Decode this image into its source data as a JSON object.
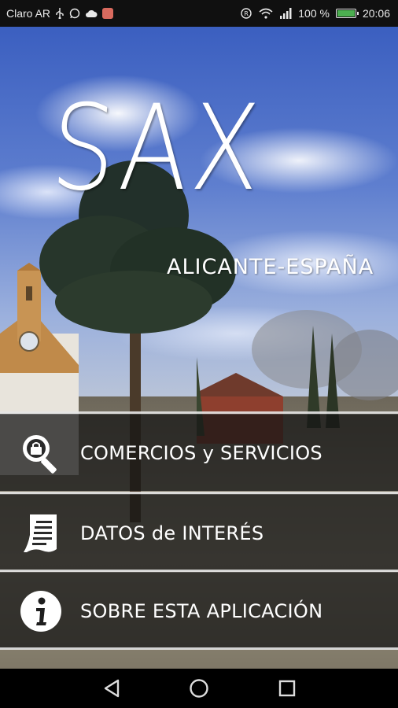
{
  "status_bar": {
    "carrier": "Claro AR",
    "battery_percent": "100 %",
    "time": "20:06",
    "battery_level": 1.0,
    "icons": [
      "usb-icon",
      "whatsapp-icon",
      "cloud-icon",
      "app-notification-icon",
      "alarm-icon",
      "wifi-icon",
      "signal-icon",
      "battery-icon"
    ]
  },
  "hero": {
    "title": "SAX",
    "subtitle": "ALICANTE-ESPAÑA"
  },
  "menu": {
    "items": [
      {
        "label": "COMERCIOS y SERVICIOS",
        "icon": "shop-search-icon"
      },
      {
        "label": "DATOS de INTERÉS",
        "icon": "document-icon"
      },
      {
        "label": "SOBRE ESTA APLICACIÓN",
        "icon": "info-icon"
      }
    ]
  },
  "nav_bar": {
    "buttons": [
      "back-icon",
      "home-icon",
      "recents-icon"
    ]
  },
  "colors": {
    "menu_bg": "#141414",
    "text": "#ffffff",
    "battery": "#4caf50"
  }
}
